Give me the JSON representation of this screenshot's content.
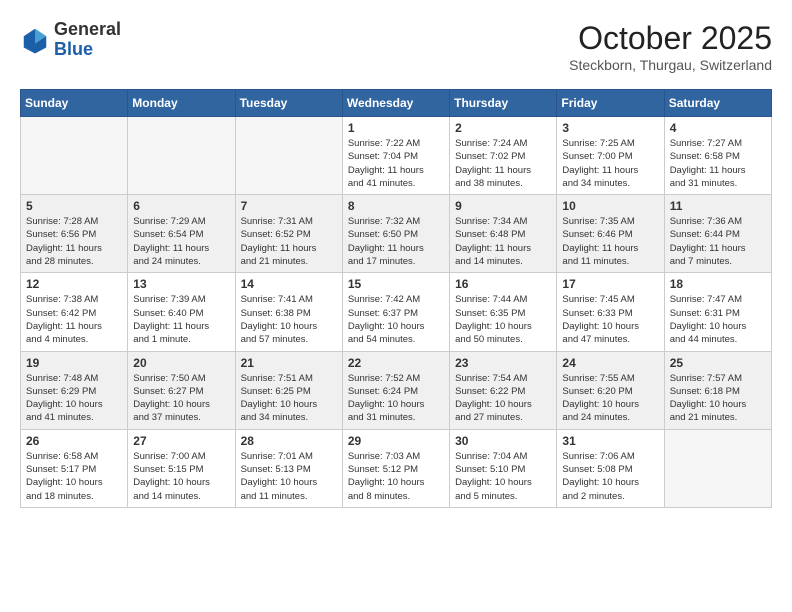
{
  "header": {
    "logo": {
      "general": "General",
      "blue": "Blue"
    },
    "month": "October 2025",
    "location": "Steckborn, Thurgau, Switzerland"
  },
  "weekdays": [
    "Sunday",
    "Monday",
    "Tuesday",
    "Wednesday",
    "Thursday",
    "Friday",
    "Saturday"
  ],
  "weeks": [
    {
      "shaded": false,
      "days": [
        {
          "num": "",
          "info": ""
        },
        {
          "num": "",
          "info": ""
        },
        {
          "num": "",
          "info": ""
        },
        {
          "num": "1",
          "info": "Sunrise: 7:22 AM\nSunset: 7:04 PM\nDaylight: 11 hours\nand 41 minutes."
        },
        {
          "num": "2",
          "info": "Sunrise: 7:24 AM\nSunset: 7:02 PM\nDaylight: 11 hours\nand 38 minutes."
        },
        {
          "num": "3",
          "info": "Sunrise: 7:25 AM\nSunset: 7:00 PM\nDaylight: 11 hours\nand 34 minutes."
        },
        {
          "num": "4",
          "info": "Sunrise: 7:27 AM\nSunset: 6:58 PM\nDaylight: 11 hours\nand 31 minutes."
        }
      ]
    },
    {
      "shaded": true,
      "days": [
        {
          "num": "5",
          "info": "Sunrise: 7:28 AM\nSunset: 6:56 PM\nDaylight: 11 hours\nand 28 minutes."
        },
        {
          "num": "6",
          "info": "Sunrise: 7:29 AM\nSunset: 6:54 PM\nDaylight: 11 hours\nand 24 minutes."
        },
        {
          "num": "7",
          "info": "Sunrise: 7:31 AM\nSunset: 6:52 PM\nDaylight: 11 hours\nand 21 minutes."
        },
        {
          "num": "8",
          "info": "Sunrise: 7:32 AM\nSunset: 6:50 PM\nDaylight: 11 hours\nand 17 minutes."
        },
        {
          "num": "9",
          "info": "Sunrise: 7:34 AM\nSunset: 6:48 PM\nDaylight: 11 hours\nand 14 minutes."
        },
        {
          "num": "10",
          "info": "Sunrise: 7:35 AM\nSunset: 6:46 PM\nDaylight: 11 hours\nand 11 minutes."
        },
        {
          "num": "11",
          "info": "Sunrise: 7:36 AM\nSunset: 6:44 PM\nDaylight: 11 hours\nand 7 minutes."
        }
      ]
    },
    {
      "shaded": false,
      "days": [
        {
          "num": "12",
          "info": "Sunrise: 7:38 AM\nSunset: 6:42 PM\nDaylight: 11 hours\nand 4 minutes."
        },
        {
          "num": "13",
          "info": "Sunrise: 7:39 AM\nSunset: 6:40 PM\nDaylight: 11 hours\nand 1 minute."
        },
        {
          "num": "14",
          "info": "Sunrise: 7:41 AM\nSunset: 6:38 PM\nDaylight: 10 hours\nand 57 minutes."
        },
        {
          "num": "15",
          "info": "Sunrise: 7:42 AM\nSunset: 6:37 PM\nDaylight: 10 hours\nand 54 minutes."
        },
        {
          "num": "16",
          "info": "Sunrise: 7:44 AM\nSunset: 6:35 PM\nDaylight: 10 hours\nand 50 minutes."
        },
        {
          "num": "17",
          "info": "Sunrise: 7:45 AM\nSunset: 6:33 PM\nDaylight: 10 hours\nand 47 minutes."
        },
        {
          "num": "18",
          "info": "Sunrise: 7:47 AM\nSunset: 6:31 PM\nDaylight: 10 hours\nand 44 minutes."
        }
      ]
    },
    {
      "shaded": true,
      "days": [
        {
          "num": "19",
          "info": "Sunrise: 7:48 AM\nSunset: 6:29 PM\nDaylight: 10 hours\nand 41 minutes."
        },
        {
          "num": "20",
          "info": "Sunrise: 7:50 AM\nSunset: 6:27 PM\nDaylight: 10 hours\nand 37 minutes."
        },
        {
          "num": "21",
          "info": "Sunrise: 7:51 AM\nSunset: 6:25 PM\nDaylight: 10 hours\nand 34 minutes."
        },
        {
          "num": "22",
          "info": "Sunrise: 7:52 AM\nSunset: 6:24 PM\nDaylight: 10 hours\nand 31 minutes."
        },
        {
          "num": "23",
          "info": "Sunrise: 7:54 AM\nSunset: 6:22 PM\nDaylight: 10 hours\nand 27 minutes."
        },
        {
          "num": "24",
          "info": "Sunrise: 7:55 AM\nSunset: 6:20 PM\nDaylight: 10 hours\nand 24 minutes."
        },
        {
          "num": "25",
          "info": "Sunrise: 7:57 AM\nSunset: 6:18 PM\nDaylight: 10 hours\nand 21 minutes."
        }
      ]
    },
    {
      "shaded": false,
      "days": [
        {
          "num": "26",
          "info": "Sunrise: 6:58 AM\nSunset: 5:17 PM\nDaylight: 10 hours\nand 18 minutes."
        },
        {
          "num": "27",
          "info": "Sunrise: 7:00 AM\nSunset: 5:15 PM\nDaylight: 10 hours\nand 14 minutes."
        },
        {
          "num": "28",
          "info": "Sunrise: 7:01 AM\nSunset: 5:13 PM\nDaylight: 10 hours\nand 11 minutes."
        },
        {
          "num": "29",
          "info": "Sunrise: 7:03 AM\nSunset: 5:12 PM\nDaylight: 10 hours\nand 8 minutes."
        },
        {
          "num": "30",
          "info": "Sunrise: 7:04 AM\nSunset: 5:10 PM\nDaylight: 10 hours\nand 5 minutes."
        },
        {
          "num": "31",
          "info": "Sunrise: 7:06 AM\nSunset: 5:08 PM\nDaylight: 10 hours\nand 2 minutes."
        },
        {
          "num": "",
          "info": ""
        }
      ]
    }
  ]
}
